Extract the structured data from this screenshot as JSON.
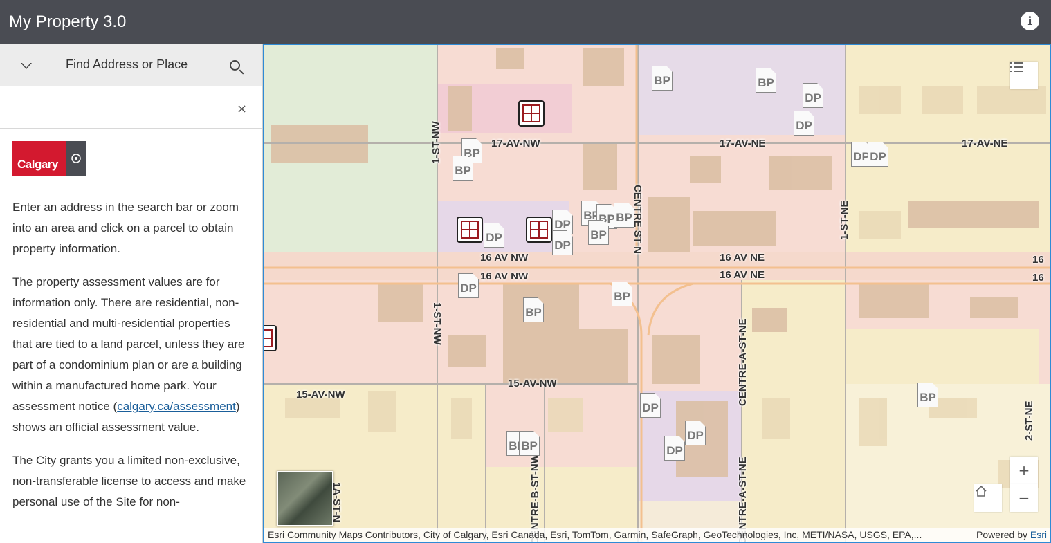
{
  "header": {
    "title": "My Property 3.0",
    "info_icon": "info-icon"
  },
  "search": {
    "label": "Find Address or Place",
    "value": "",
    "clear": "×"
  },
  "logo": {
    "text": "Calgary"
  },
  "content": {
    "p1": "Enter an address in the search bar or zoom into an area and click on a parcel to obtain property information.",
    "p2_before": "The property assessment values are for information only. There are residential, non-residential and multi-residential properties that are tied to a land parcel, unless they are part of a condominium plan or are a building within a manufactured home park. Your assessment notice (",
    "p2_link": "calgary.ca/assessment",
    "p2_after": ") shows an official assessment value.",
    "p3": "The City grants you a limited non-exclusive, non-transferable license to access and make personal use of the Site for non-"
  },
  "map": {
    "streets": {
      "av17nw": "17-AV-NW",
      "av17ne_a": "17-AV-NE",
      "av17ne_b": "17-AV-NE",
      "av16nw_a": "16 AV NW",
      "av16nw_b": "16 AV NW",
      "av16ne_a": "16 AV NE",
      "av16ne_b": "16 AV NE",
      "av16_edge_a": "16",
      "av16_edge_b": "16",
      "av15nw_a": "15-AV-NW",
      "av15nw_b": "15-AV-NW",
      "st1nw_a": "1-ST-NW",
      "st1nw_b": "1-ST-NW",
      "centre_st": "CENTRE ST N",
      "st1ne": "1-ST-NE",
      "centre_a_st": "CENTRE-A-ST-NE",
      "centre_a_st_b": "CENTRE-A-ST-NE",
      "st2ne": "2-ST-NE",
      "centre_b_st": "CENTRE-B-ST-NW",
      "st1a": "1A-ST-N"
    },
    "markers": {
      "bp": "BP",
      "dp": "DP"
    },
    "controls": {
      "zoom_in": "+",
      "zoom_out": "−",
      "home_icon": "home-icon",
      "layers_icon": "layer-list-icon"
    },
    "attribution": "Esri Community Maps Contributors, City of Calgary, Esri Canada, Esri, TomTom, Garmin, SafeGraph, GeoTechnologies, Inc, METI/NASA, USGS, EPA,...",
    "powered_by": "Powered by ",
    "powered_link": "Esri"
  }
}
